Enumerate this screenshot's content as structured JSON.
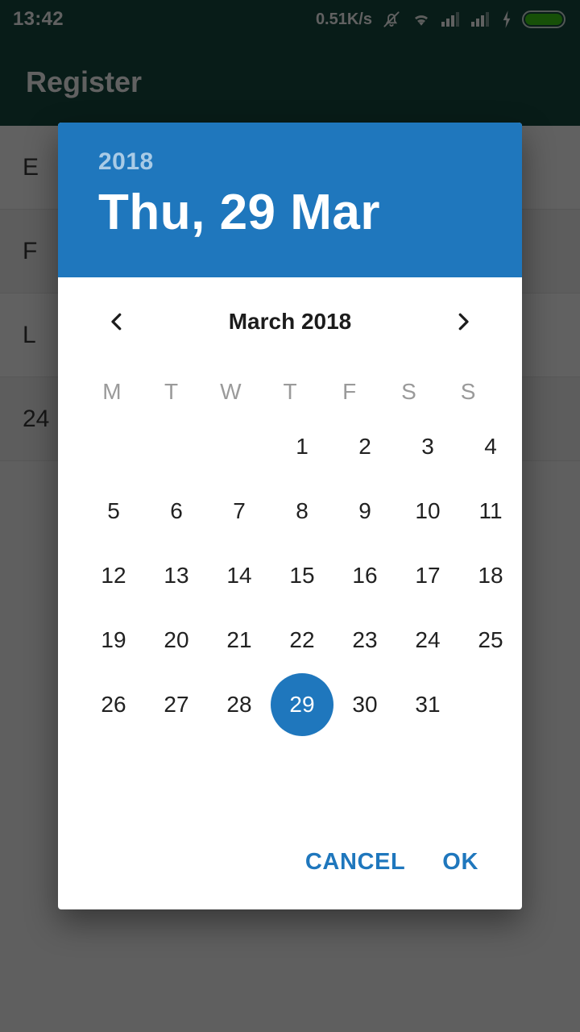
{
  "status_bar": {
    "clock": "13:42",
    "network_speed": "0.51K/s",
    "icons": [
      "bell-mute-icon",
      "wifi-icon",
      "signal-sim1-icon",
      "signal-sim2-icon",
      "charging-bolt-icon",
      "battery-icon"
    ],
    "battery_color": "#3ed117",
    "background_color": "#154a40"
  },
  "app_bar": {
    "title": "Register",
    "background_color": "#154a40"
  },
  "background_form": {
    "rows": [
      "E",
      "F",
      "L",
      "24"
    ]
  },
  "dialog": {
    "accent_color": "#1f77bd",
    "header": {
      "year": "2018",
      "date": "Thu, 29 Mar"
    },
    "month_nav": {
      "previous_label": "‹",
      "next_label": "›",
      "month_label": "March 2018"
    },
    "weekdays": [
      "M",
      "T",
      "W",
      "T",
      "F",
      "S",
      "S"
    ],
    "weeks": [
      [
        "",
        "",
        "",
        "1",
        "2",
        "3",
        "4"
      ],
      [
        "5",
        "6",
        "7",
        "8",
        "9",
        "10",
        "11"
      ],
      [
        "12",
        "13",
        "14",
        "15",
        "16",
        "17",
        "18"
      ],
      [
        "19",
        "20",
        "21",
        "22",
        "23",
        "24",
        "25"
      ],
      [
        "26",
        "27",
        "28",
        "29",
        "30",
        "31",
        ""
      ]
    ],
    "selected_day": "29",
    "actions": {
      "cancel_label": "CANCEL",
      "ok_label": "OK"
    }
  }
}
